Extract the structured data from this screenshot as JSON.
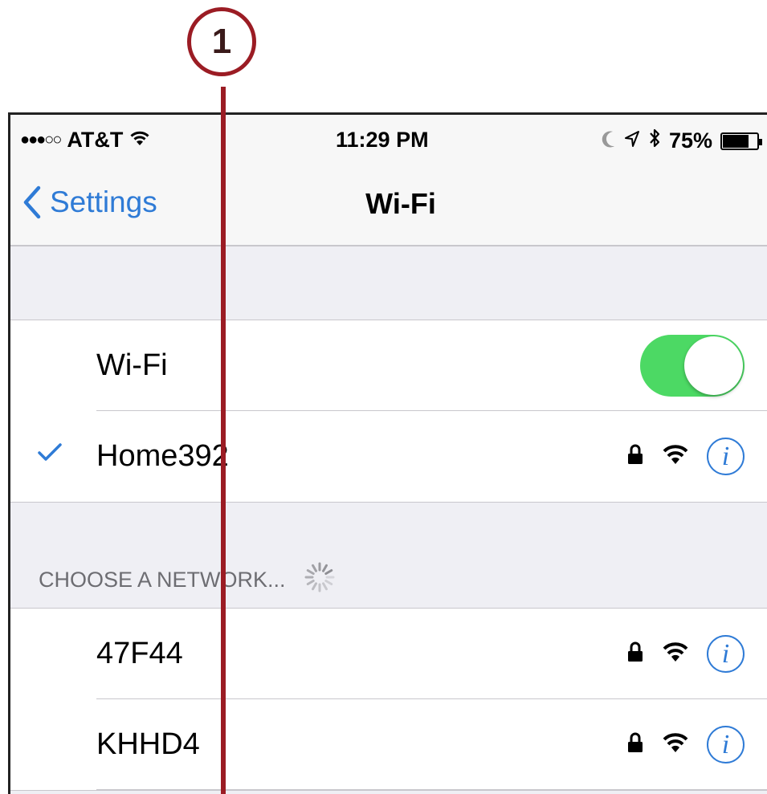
{
  "callout": {
    "number": "1",
    "color": "#9b1c24"
  },
  "status_bar": {
    "signal": "●●●○○",
    "carrier": "AT&T",
    "time": "11:29 PM",
    "battery_percent": "75%",
    "battery_level": 0.75,
    "icons": [
      "wifi-icon",
      "moon-icon",
      "location-arrow-icon",
      "bluetooth-icon",
      "battery-icon"
    ]
  },
  "nav": {
    "back_label": "Settings",
    "title": "Wi-Fi"
  },
  "wifi_toggle": {
    "label": "Wi-Fi",
    "on": true
  },
  "connected": {
    "name": "Home392",
    "icons": [
      "checkmark-icon",
      "lock-icon",
      "wifi-icon",
      "info-icon"
    ]
  },
  "choose_network": {
    "header": "CHOOSE A NETWORK...",
    "networks": [
      {
        "name": "47F44"
      },
      {
        "name": "KHHD4"
      }
    ]
  },
  "colors": {
    "accent": "#2f7bd6",
    "toggle_on": "#4cd964",
    "background": "#efeff4"
  }
}
